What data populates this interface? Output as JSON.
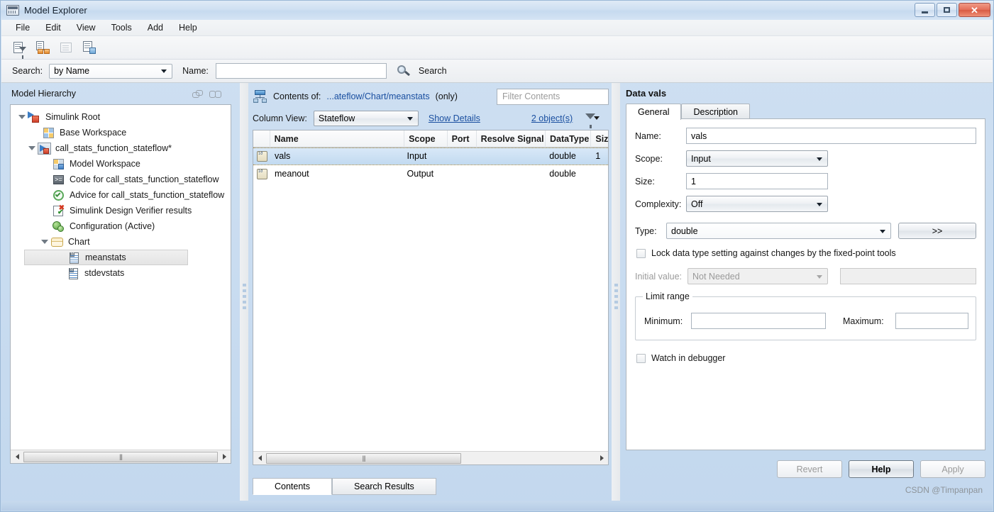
{
  "window": {
    "title": "Model Explorer",
    "icon": "model-explorer-icon",
    "minimize": "–",
    "maximize": "□",
    "close": "✕"
  },
  "menubar": {
    "items": [
      "File",
      "Edit",
      "View",
      "Tools",
      "Add",
      "Help"
    ]
  },
  "toolbar": {
    "buttons": [
      {
        "name": "search-filter-icon",
        "enabled": true
      },
      {
        "name": "link-blocks-icon",
        "enabled": true
      },
      {
        "name": "properties-icon",
        "enabled": false
      },
      {
        "name": "copy-document-icon",
        "enabled": true
      }
    ]
  },
  "searchbar": {
    "search_label": "Search:",
    "search_by_value": "by Name",
    "name_label": "Name:",
    "name_value": "",
    "name_placeholder": "",
    "search_button": "Search",
    "search_icon": "magnifier-icon"
  },
  "left_panel": {
    "header": "Model Hierarchy",
    "icons": [
      "link-icon",
      "glasses-icon"
    ],
    "tree": [
      {
        "label": "Simulink Root",
        "indent": 0,
        "icon": "simulink-root-icon",
        "expander": "down",
        "selected": false
      },
      {
        "label": "Base Workspace",
        "indent": 1,
        "icon": "base-workspace-icon",
        "expander": "none",
        "selected": false
      },
      {
        "label": "call_stats_function_stateflow*",
        "indent": 1,
        "icon": "model-icon",
        "expander": "down",
        "selected": false
      },
      {
        "label": "Model Workspace",
        "indent": 2,
        "icon": "model-workspace-icon",
        "expander": "none",
        "selected": false
      },
      {
        "label": "Code for call_stats_function_stateflow",
        "indent": 2,
        "icon": "code-icon",
        "expander": "none",
        "selected": false
      },
      {
        "label": "Advice for call_stats_function_stateflow",
        "indent": 2,
        "icon": "advice-icon",
        "expander": "none",
        "selected": false
      },
      {
        "label": "Simulink Design Verifier results",
        "indent": 2,
        "icon": "design-verifier-icon",
        "expander": "none",
        "selected": false
      },
      {
        "label": "Configuration (Active)",
        "indent": 2,
        "icon": "configuration-icon",
        "expander": "none",
        "selected": false
      },
      {
        "label": "Chart",
        "indent": 2,
        "icon": "chart-icon",
        "expander": "down",
        "selected": false
      },
      {
        "label": "meanstats",
        "indent": 3,
        "icon": "function-icon",
        "expander": "none",
        "selected": true
      },
      {
        "label": "stdevstats",
        "indent": 3,
        "icon": "function-icon",
        "expander": "none",
        "selected": false
      }
    ],
    "scrollbar_grip": "|||"
  },
  "mid_panel": {
    "contents_icon": "hierarchy-icon",
    "contents_label": "Contents of:",
    "contents_path": "...ateflow/Chart/meanstats",
    "contents_only": "(only)",
    "filter_placeholder": "Filter Contents",
    "filter_value": "",
    "column_view_label": "Column View:",
    "column_view_value": "Stateflow",
    "show_details": "Show Details",
    "object_count": "2 object(s)",
    "filter_icon": "filter-dropdown-icon",
    "table": {
      "columns": [
        "Name",
        "Scope",
        "Port",
        "Resolve Signal",
        "DataType",
        "Siz"
      ],
      "rows": [
        {
          "icon": "data-icon",
          "Name": "vals",
          "Scope": "Input",
          "Port": "",
          "Resolve Signal": "",
          "DataType": "double",
          "Siz": "1",
          "selected": true
        },
        {
          "icon": "data-icon",
          "Name": "meanout",
          "Scope": "Output",
          "Port": "",
          "Resolve Signal": "",
          "DataType": "double",
          "Siz": "",
          "selected": false
        }
      ]
    },
    "tabs": [
      {
        "label": "Contents",
        "active": true
      },
      {
        "label": "Search Results",
        "active": false
      }
    ],
    "scrollbar_grip": "|||"
  },
  "right_panel": {
    "title": "Data vals",
    "tabs": [
      {
        "label": "General",
        "active": true
      },
      {
        "label": "Description",
        "active": false
      }
    ],
    "fields": {
      "name_label": "Name:",
      "name_value": "vals",
      "scope_label": "Scope:",
      "scope_value": "Input",
      "size_label": "Size:",
      "size_value": "1",
      "complexity_label": "Complexity:",
      "complexity_value": "Off",
      "type_label": "Type:",
      "type_value": "double",
      "type_more_button": ">>",
      "lock_checkbox_label": "Lock data type setting against changes by the fixed-point tools",
      "lock_checked": false,
      "initial_value_label": "Initial value:",
      "initial_value_value": "Not Needed",
      "initial_value_extra": "",
      "limit_range_title": "Limit range",
      "minimum_label": "Minimum:",
      "minimum_value": "",
      "maximum_label": "Maximum:",
      "maximum_value": "",
      "watch_checkbox_label": "Watch in debugger",
      "watch_checked": false
    },
    "buttons": {
      "revert": "Revert",
      "help": "Help",
      "apply": "Apply"
    }
  },
  "watermark": "CSDN @Timpanpan"
}
